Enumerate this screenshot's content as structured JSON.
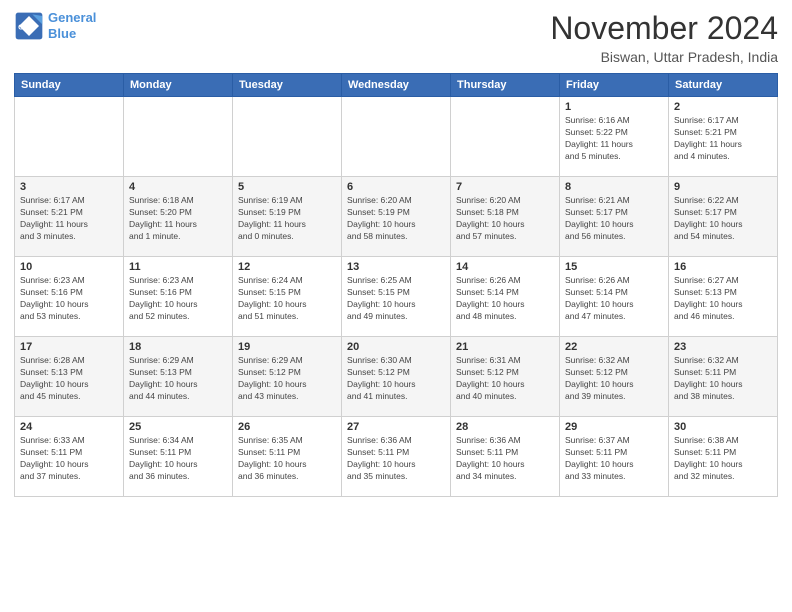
{
  "logo": {
    "line1": "General",
    "line2": "Blue"
  },
  "header": {
    "month": "November 2024",
    "location": "Biswan, Uttar Pradesh, India"
  },
  "weekdays": [
    "Sunday",
    "Monday",
    "Tuesday",
    "Wednesday",
    "Thursday",
    "Friday",
    "Saturday"
  ],
  "weeks": [
    [
      {
        "day": "",
        "info": ""
      },
      {
        "day": "",
        "info": ""
      },
      {
        "day": "",
        "info": ""
      },
      {
        "day": "",
        "info": ""
      },
      {
        "day": "",
        "info": ""
      },
      {
        "day": "1",
        "info": "Sunrise: 6:16 AM\nSunset: 5:22 PM\nDaylight: 11 hours\nand 5 minutes."
      },
      {
        "day": "2",
        "info": "Sunrise: 6:17 AM\nSunset: 5:21 PM\nDaylight: 11 hours\nand 4 minutes."
      }
    ],
    [
      {
        "day": "3",
        "info": "Sunrise: 6:17 AM\nSunset: 5:21 PM\nDaylight: 11 hours\nand 3 minutes."
      },
      {
        "day": "4",
        "info": "Sunrise: 6:18 AM\nSunset: 5:20 PM\nDaylight: 11 hours\nand 1 minute."
      },
      {
        "day": "5",
        "info": "Sunrise: 6:19 AM\nSunset: 5:19 PM\nDaylight: 11 hours\nand 0 minutes."
      },
      {
        "day": "6",
        "info": "Sunrise: 6:20 AM\nSunset: 5:19 PM\nDaylight: 10 hours\nand 58 minutes."
      },
      {
        "day": "7",
        "info": "Sunrise: 6:20 AM\nSunset: 5:18 PM\nDaylight: 10 hours\nand 57 minutes."
      },
      {
        "day": "8",
        "info": "Sunrise: 6:21 AM\nSunset: 5:17 PM\nDaylight: 10 hours\nand 56 minutes."
      },
      {
        "day": "9",
        "info": "Sunrise: 6:22 AM\nSunset: 5:17 PM\nDaylight: 10 hours\nand 54 minutes."
      }
    ],
    [
      {
        "day": "10",
        "info": "Sunrise: 6:23 AM\nSunset: 5:16 PM\nDaylight: 10 hours\nand 53 minutes."
      },
      {
        "day": "11",
        "info": "Sunrise: 6:23 AM\nSunset: 5:16 PM\nDaylight: 10 hours\nand 52 minutes."
      },
      {
        "day": "12",
        "info": "Sunrise: 6:24 AM\nSunset: 5:15 PM\nDaylight: 10 hours\nand 51 minutes."
      },
      {
        "day": "13",
        "info": "Sunrise: 6:25 AM\nSunset: 5:15 PM\nDaylight: 10 hours\nand 49 minutes."
      },
      {
        "day": "14",
        "info": "Sunrise: 6:26 AM\nSunset: 5:14 PM\nDaylight: 10 hours\nand 48 minutes."
      },
      {
        "day": "15",
        "info": "Sunrise: 6:26 AM\nSunset: 5:14 PM\nDaylight: 10 hours\nand 47 minutes."
      },
      {
        "day": "16",
        "info": "Sunrise: 6:27 AM\nSunset: 5:13 PM\nDaylight: 10 hours\nand 46 minutes."
      }
    ],
    [
      {
        "day": "17",
        "info": "Sunrise: 6:28 AM\nSunset: 5:13 PM\nDaylight: 10 hours\nand 45 minutes."
      },
      {
        "day": "18",
        "info": "Sunrise: 6:29 AM\nSunset: 5:13 PM\nDaylight: 10 hours\nand 44 minutes."
      },
      {
        "day": "19",
        "info": "Sunrise: 6:29 AM\nSunset: 5:12 PM\nDaylight: 10 hours\nand 43 minutes."
      },
      {
        "day": "20",
        "info": "Sunrise: 6:30 AM\nSunset: 5:12 PM\nDaylight: 10 hours\nand 41 minutes."
      },
      {
        "day": "21",
        "info": "Sunrise: 6:31 AM\nSunset: 5:12 PM\nDaylight: 10 hours\nand 40 minutes."
      },
      {
        "day": "22",
        "info": "Sunrise: 6:32 AM\nSunset: 5:12 PM\nDaylight: 10 hours\nand 39 minutes."
      },
      {
        "day": "23",
        "info": "Sunrise: 6:32 AM\nSunset: 5:11 PM\nDaylight: 10 hours\nand 38 minutes."
      }
    ],
    [
      {
        "day": "24",
        "info": "Sunrise: 6:33 AM\nSunset: 5:11 PM\nDaylight: 10 hours\nand 37 minutes."
      },
      {
        "day": "25",
        "info": "Sunrise: 6:34 AM\nSunset: 5:11 PM\nDaylight: 10 hours\nand 36 minutes."
      },
      {
        "day": "26",
        "info": "Sunrise: 6:35 AM\nSunset: 5:11 PM\nDaylight: 10 hours\nand 36 minutes."
      },
      {
        "day": "27",
        "info": "Sunrise: 6:36 AM\nSunset: 5:11 PM\nDaylight: 10 hours\nand 35 minutes."
      },
      {
        "day": "28",
        "info": "Sunrise: 6:36 AM\nSunset: 5:11 PM\nDaylight: 10 hours\nand 34 minutes."
      },
      {
        "day": "29",
        "info": "Sunrise: 6:37 AM\nSunset: 5:11 PM\nDaylight: 10 hours\nand 33 minutes."
      },
      {
        "day": "30",
        "info": "Sunrise: 6:38 AM\nSunset: 5:11 PM\nDaylight: 10 hours\nand 32 minutes."
      }
    ]
  ]
}
